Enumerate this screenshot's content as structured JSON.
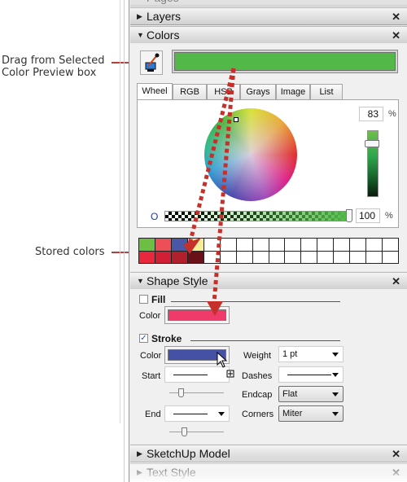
{
  "annotations": {
    "drag_source_line1": "Drag from Selected",
    "drag_source_line2": "Color Preview box",
    "stored_colors": "Stored colors"
  },
  "panels": {
    "pages": {
      "title": "Pages"
    },
    "layers": {
      "title": "Layers",
      "expanded": false,
      "close": "✕",
      "collapse_icon": "triangle-right"
    },
    "colors": {
      "title": "Colors",
      "expanded": true,
      "close": "✕",
      "collapse_icon": "triangle-down"
    },
    "shape_style": {
      "title": "Shape Style",
      "expanded": true,
      "close": "✕"
    },
    "sketchup_model": {
      "title": "SketchUp Model",
      "expanded": false,
      "close": "✕"
    },
    "text_style": {
      "title": "Text Style",
      "expanded": false,
      "close": "✕"
    }
  },
  "colors": {
    "eyedropper_icon": "eyedropper-icon",
    "selected_color": "#52b848",
    "tabs": [
      "Wheel",
      "RGB",
      "HSB",
      "Grays",
      "Image",
      "List"
    ],
    "active_tab": "Wheel",
    "brightness_value": "83",
    "brightness_unit": "%",
    "opacity_label": "O",
    "opacity_value": "100",
    "opacity_unit": "%",
    "stored_colors": {
      "row1": [
        "#6cbf43",
        "#ec4f56",
        "#4a56a6",
        "#f6ee96",
        "",
        "",
        "",
        "",
        "",
        "",
        "",
        "",
        "",
        "",
        "",
        ""
      ],
      "row2": [
        "#e8283c",
        "#d11f35",
        "#b21f2d",
        "#6a1017",
        "",
        "",
        "",
        "",
        "",
        "",
        "",
        "",
        "",
        "",
        "",
        ""
      ]
    }
  },
  "shape_style": {
    "fill": {
      "label": "Fill",
      "checked": false,
      "color_label": "Color",
      "color": "#ee3b6a"
    },
    "stroke": {
      "label": "Stroke",
      "checked": true,
      "check_glyph": "✓",
      "color_label": "Color",
      "color": "#4451a5",
      "weight_label": "Weight",
      "weight_value": "1 pt",
      "start_label": "Start",
      "dashes_label": "Dashes",
      "endcap_label": "Endcap",
      "endcap_value": "Flat",
      "end_label": "End",
      "corners_label": "Corners",
      "corners_value": "Miter"
    }
  },
  "accent": {
    "annotation_red": "#c62f2a"
  }
}
